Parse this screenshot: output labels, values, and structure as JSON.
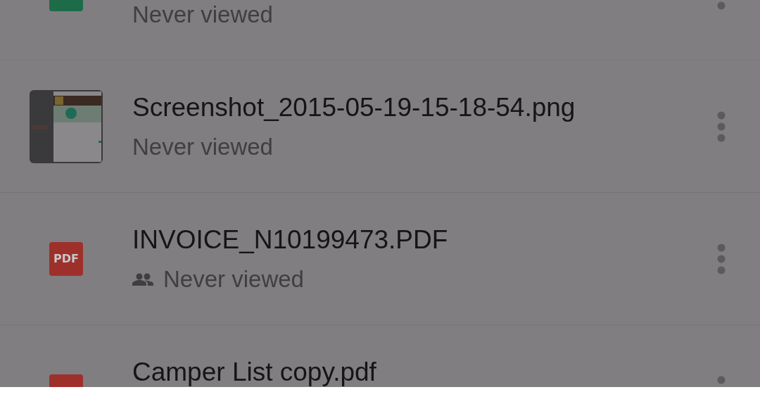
{
  "files": [
    {
      "kind": "spreadsheet",
      "subtitle": "Never viewed"
    },
    {
      "kind": "image",
      "title": "Screenshot_2015-05-19-15-18-54.png",
      "subtitle": "Never viewed"
    },
    {
      "kind": "pdf",
      "icon_text": "PDF",
      "title": "INVOICE_N10199473.PDF",
      "subtitle": "Never viewed",
      "shared": true
    },
    {
      "kind": "pdf",
      "title": "Camper List copy.pdf"
    }
  ]
}
